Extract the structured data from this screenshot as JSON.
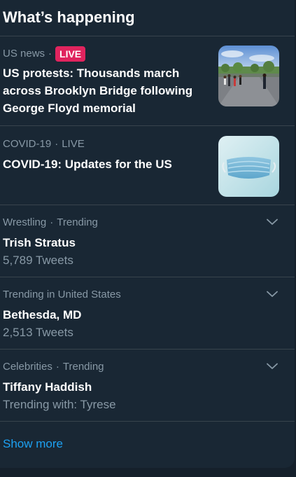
{
  "header": {
    "title": "What’s happening"
  },
  "items": [
    {
      "category": "US news",
      "separator": "·",
      "live_badge": "LIVE",
      "headline": "US protests: Thousands march across Brooklyn Bridge following George Floyd memorial",
      "image": "protest-march-photo"
    },
    {
      "category": "COVID-19",
      "separator": "·",
      "status": "LIVE",
      "headline": "COVID-19: Updates for the US",
      "image": "face-mask-photo"
    },
    {
      "category": "Wrestling",
      "separator": "·",
      "context": "Trending",
      "headline": "Trish Stratus",
      "subline": "5,789 Tweets",
      "icon": "chevron-down-icon"
    },
    {
      "category": "Trending in United States",
      "headline": "Bethesda, MD",
      "subline": "2,513 Tweets",
      "icon": "chevron-down-icon"
    },
    {
      "category": "Celebrities",
      "separator": "·",
      "context": "Trending",
      "headline": "Tiffany Haddish",
      "subline": "Trending with: Tyrese",
      "icon": "chevron-down-icon"
    }
  ],
  "footer": {
    "show_more": "Show more"
  },
  "colors": {
    "background": "#15202b",
    "panel": "#192734",
    "divider": "#38444d",
    "secondary_text": "#8899a6",
    "accent": "#1da1f2",
    "live_badge": "#e0245e"
  }
}
